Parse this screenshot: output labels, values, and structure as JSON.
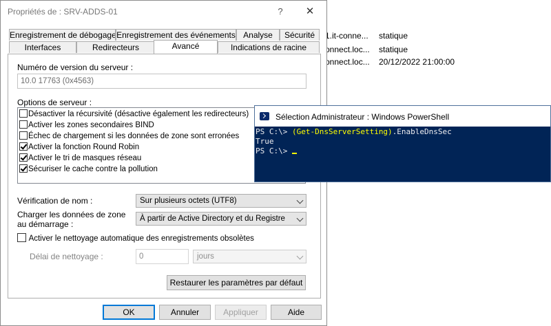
{
  "background_rows": [
    {
      "name": "1.it-conne...",
      "type": "statique"
    },
    {
      "name": "onnect.loc...",
      "type": "statique"
    },
    {
      "name": "onnect.loc...",
      "type": "20/12/2022 21:00:00"
    }
  ],
  "dialog": {
    "title": "Propriétés de : SRV-ADDS-01",
    "help_glyph": "?",
    "close_glyph": "✕",
    "tabs_row1": [
      "Enregistrement de débogage",
      "Enregistrement des événements",
      "Analyse",
      "Sécurité"
    ],
    "tabs_row2": [
      "Interfaces",
      "Redirecteurs",
      "Avancé",
      "Indications de racine"
    ],
    "active_tab": "Avancé",
    "version_label": "Numéro de version du serveur :",
    "version_value": "10.0 17763 (0x4563)",
    "options_label": "Options de serveur :",
    "options": [
      {
        "label": "Désactiver la récursivité (désactive également les redirecteurs)",
        "checked": false
      },
      {
        "label": "Activer les zones secondaires BIND",
        "checked": false
      },
      {
        "label": "Échec de chargement si les données de zone sont erronées",
        "checked": false
      },
      {
        "label": "Activer la fonction Round Robin",
        "checked": true
      },
      {
        "label": "Activer le tri de masques réseau",
        "checked": true
      },
      {
        "label": "Sécuriser le cache contre la pollution",
        "checked": true
      }
    ],
    "name_check_label": "Vérification de nom :",
    "name_check_value": "Sur plusieurs octets (UTF8)",
    "load_zone_label_1": "Charger les données de zone",
    "load_zone_label_2": "au démarrage :",
    "load_zone_value": "À partir de Active Directory et du Registre",
    "scavenging_label": "Activer le nettoyage automatique des enregistrements obsolètes",
    "scavenging_checked": false,
    "scavenging_delay_label": "Délai de nettoyage :",
    "scavenging_delay_value": "0",
    "scavenging_unit": "jours",
    "restore_defaults": "Restaurer les paramètres par défaut",
    "ok": "OK",
    "cancel": "Annuler",
    "apply": "Appliquer",
    "help": "Aide"
  },
  "powershell": {
    "title": "Sélection Administrateur : Windows PowerShell",
    "prompt": "PS C:\\> ",
    "command": "(Get-DnsServerSetting)",
    "command_suffix": ".EnableDnsSec",
    "output": "True",
    "prompt2": "PS C:\\> ",
    "colors": {
      "background": "#012456",
      "text": "#eeedf0",
      "command": "#ffff00"
    }
  }
}
